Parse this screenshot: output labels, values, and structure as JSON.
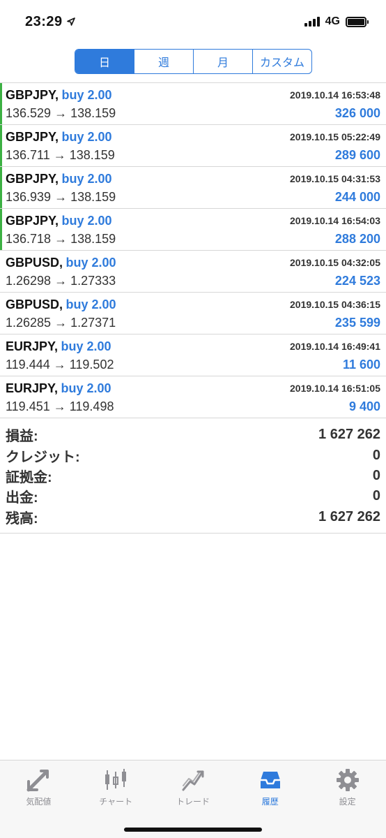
{
  "status_bar": {
    "time": "23:29",
    "network": "4G",
    "icons": [
      "location-arrow-icon",
      "signal-icon",
      "battery-icon"
    ]
  },
  "period_tabs": [
    {
      "label": "日",
      "active": true
    },
    {
      "label": "週",
      "active": false
    },
    {
      "label": "月",
      "active": false
    },
    {
      "label": "カスタム",
      "active": false
    }
  ],
  "trades": [
    {
      "symbol": "GBPJPY,",
      "side": "buy 2.00",
      "time": "2019.10.14 16:53:48",
      "prices": "136.529 → 138.159",
      "profit": "326 000",
      "bar": true
    },
    {
      "symbol": "GBPJPY,",
      "side": "buy 2.00",
      "time": "2019.10.15 05:22:49",
      "prices": "136.711 → 138.159",
      "profit": "289 600",
      "bar": true
    },
    {
      "symbol": "GBPJPY,",
      "side": "buy 2.00",
      "time": "2019.10.15 04:31:53",
      "prices": "136.939 → 138.159",
      "profit": "244 000",
      "bar": true
    },
    {
      "symbol": "GBPJPY,",
      "side": "buy 2.00",
      "time": "2019.10.14 16:54:03",
      "prices": "136.718 → 138.159",
      "profit": "288 200",
      "bar": true
    },
    {
      "symbol": "GBPUSD,",
      "side": "buy 2.00",
      "time": "2019.10.15 04:32:05",
      "prices": "1.26298 → 1.27333",
      "profit": "224 523",
      "bar": false
    },
    {
      "symbol": "GBPUSD,",
      "side": "buy 2.00",
      "time": "2019.10.15 04:36:15",
      "prices": "1.26285 → 1.27371",
      "profit": "235 599",
      "bar": false
    },
    {
      "symbol": "EURJPY,",
      "side": "buy 2.00",
      "time": "2019.10.14 16:49:41",
      "prices": "119.444 → 119.502",
      "profit": "11 600",
      "bar": false
    },
    {
      "symbol": "EURJPY,",
      "side": "buy 2.00",
      "time": "2019.10.14 16:51:05",
      "prices": "119.451 → 119.498",
      "profit": "9 400",
      "bar": false
    }
  ],
  "summary": [
    {
      "label": "損益:",
      "value": "1 627 262"
    },
    {
      "label": "クレジット:",
      "value": "0"
    },
    {
      "label": "証拠金:",
      "value": "0"
    },
    {
      "label": "出金:",
      "value": "0"
    },
    {
      "label": "残高:",
      "value": "1 627 262"
    }
  ],
  "tabbar": [
    {
      "label": "気配値",
      "icon": "quotes-icon",
      "active": false
    },
    {
      "label": "チャート",
      "icon": "candlestick-chart-icon",
      "active": false
    },
    {
      "label": "トレード",
      "icon": "trade-icon",
      "active": false
    },
    {
      "label": "履歴",
      "icon": "history-tray-icon",
      "active": true
    },
    {
      "label": "設定",
      "icon": "settings-gear-icon",
      "active": false
    }
  ],
  "colors": {
    "accent": "#2f7bdc",
    "profit_bar": "#3cb043",
    "inactive_tab": "#8e8e93"
  }
}
